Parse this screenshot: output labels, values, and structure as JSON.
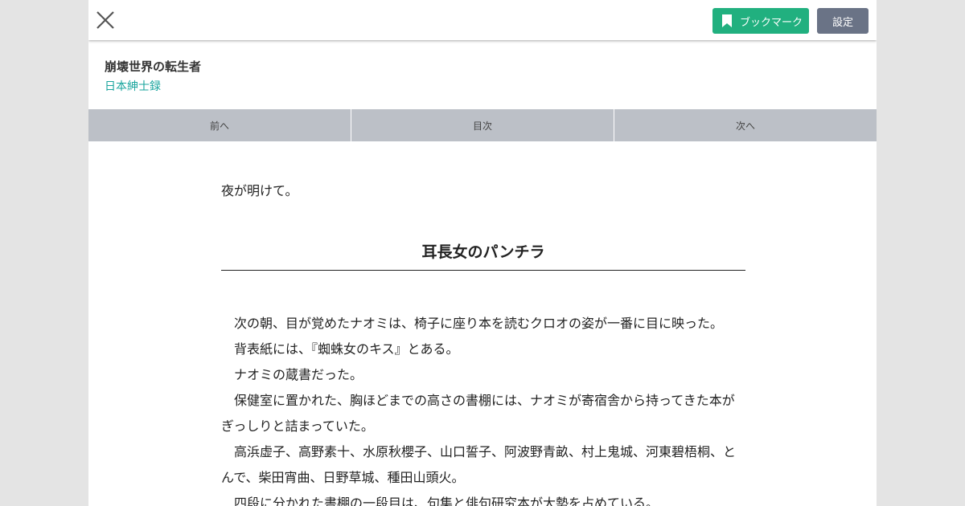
{
  "header": {
    "bookmark_label": "ブックマーク",
    "settings_label": "設定",
    "close_icon": "close-icon",
    "bookmark_icon": "bookmark-icon",
    "bookmark_color": "#21b07f",
    "settings_color": "#6a7386"
  },
  "work": {
    "title": "崩壊世界の転生者",
    "author": "日本紳士録",
    "author_color": "#1aa59e"
  },
  "nav": {
    "prev": "前へ",
    "toc": "目次",
    "next": "次へ"
  },
  "content": {
    "intro": "夜が明けて。",
    "chapter_title": "耳長女のパンチラ",
    "paragraphs": [
      "次の朝、目が覚めたナオミは、椅子に座り本を読むクロオの姿が一番に目に映った。",
      "背表紙には、『蜘蛛女のキス』とある。",
      "ナオミの蔵書だった。",
      "保健室に置かれた、胸ほどまでの高さの書棚には、ナオミが寄宿舎から持ってきた本がぎっしりと詰まっていた。",
      "高浜虚子、高野素十、水原秋櫻子、山口誓子、阿波野青畝、村上鬼城、河東碧梧桐、とんで、柴田宵曲、日野草城、種田山頭火。",
      "四段に分かれた書棚の一段目は、句集と俳句研究本が大勢を占めている。"
    ]
  }
}
